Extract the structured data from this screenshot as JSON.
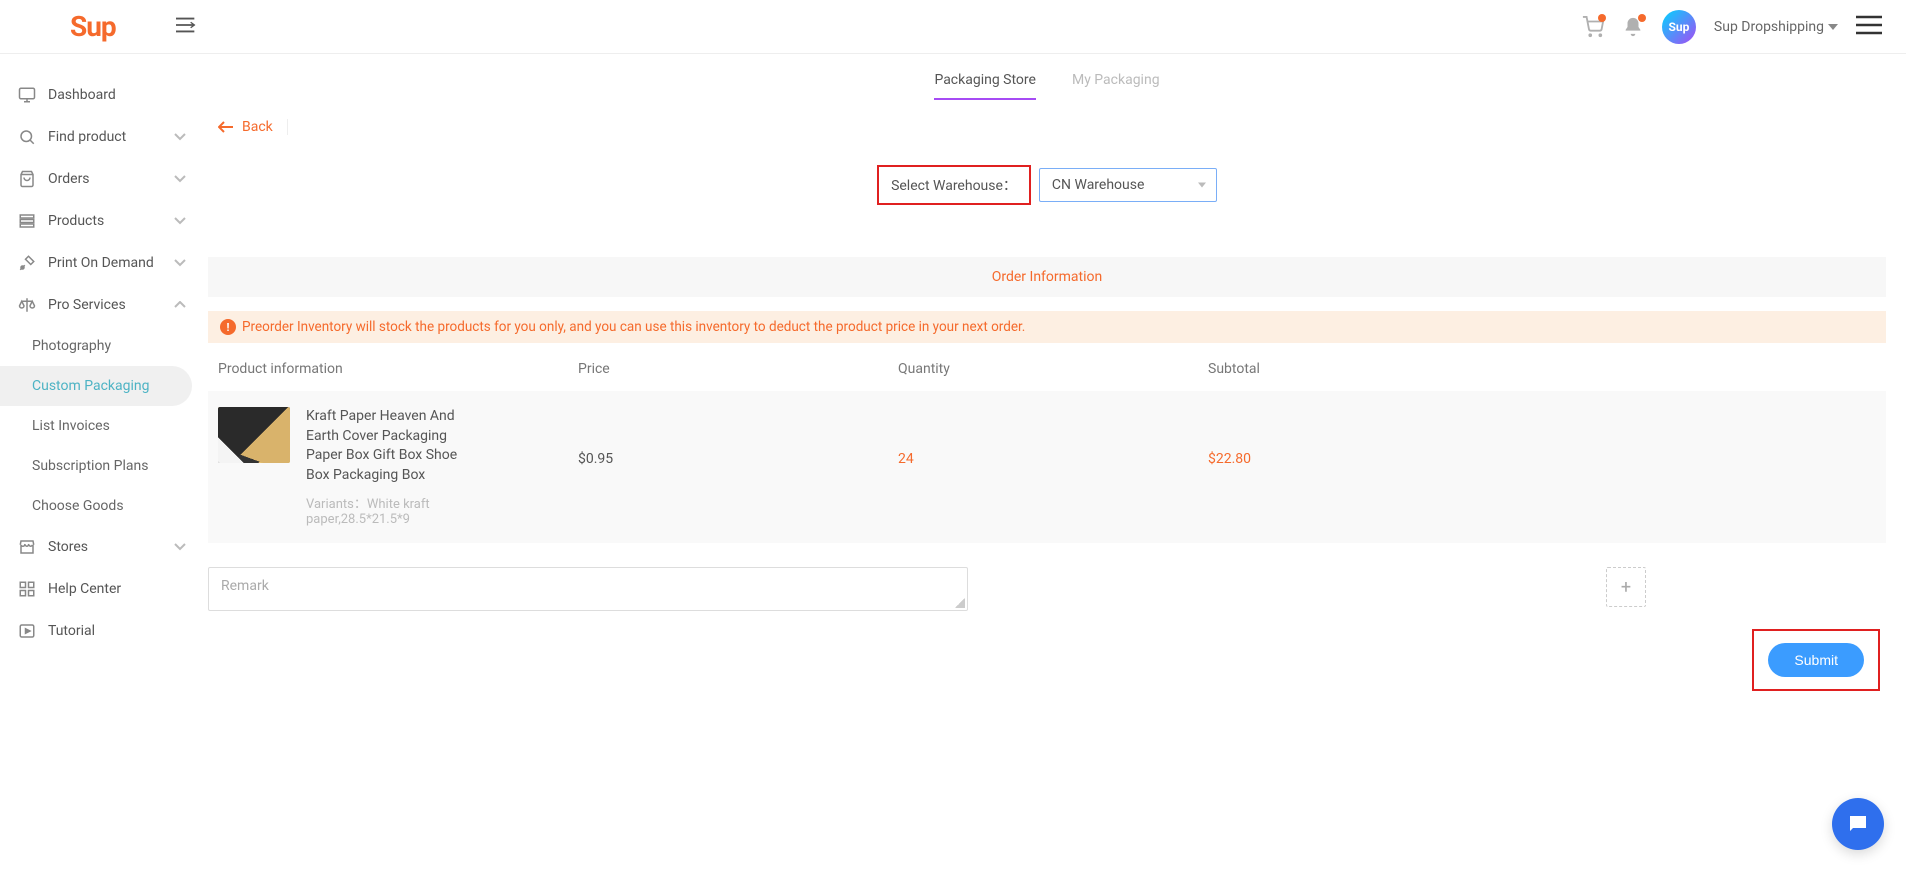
{
  "header": {
    "logo_text": "Sup",
    "user_label": "Sup Dropshipping",
    "avatar_text": "Sup"
  },
  "sidebar": {
    "dashboard": "Dashboard",
    "find_product": "Find product",
    "orders": "Orders",
    "products": "Products",
    "print_on_demand": "Print On Demand",
    "pro_services": "Pro Services",
    "pro_children": {
      "photography": "Photography",
      "custom_packaging": "Custom Packaging",
      "list_invoices": "List Invoices",
      "subscription_plans": "Subscription Plans",
      "choose_goods": "Choose Goods"
    },
    "stores": "Stores",
    "help_center": "Help Center",
    "tutorial": "Tutorial"
  },
  "tabs": {
    "packaging_store": "Packaging Store",
    "my_packaging": "My Packaging"
  },
  "back_label": "Back",
  "warehouse": {
    "label": "Select Warehouse：",
    "selected": "CN Warehouse"
  },
  "order_info": {
    "heading": "Order Information",
    "banner": "Preorder Inventory will stock the products for you only, and you can use this inventory to deduct the product price in your next order."
  },
  "table": {
    "headers": {
      "product": "Product information",
      "price": "Price",
      "quantity": "Quantity",
      "subtotal": "Subtotal"
    },
    "row": {
      "title": "Kraft Paper Heaven And Earth Cover Packaging Paper Box Gift Box Shoe Box Packaging Box",
      "variant_label": "Variants：",
      "variant_value": "White kraft paper,28.5*21.5*9",
      "price": "$0.95",
      "quantity": "24",
      "subtotal": "$22.80"
    }
  },
  "remark_placeholder": "Remark",
  "submit_label": "Submit",
  "colors": {
    "accent_orange": "#f56a2c",
    "accent_blue": "#3b9cff",
    "highlight_red": "#e02020",
    "tab_purple": "#a64bf4"
  }
}
